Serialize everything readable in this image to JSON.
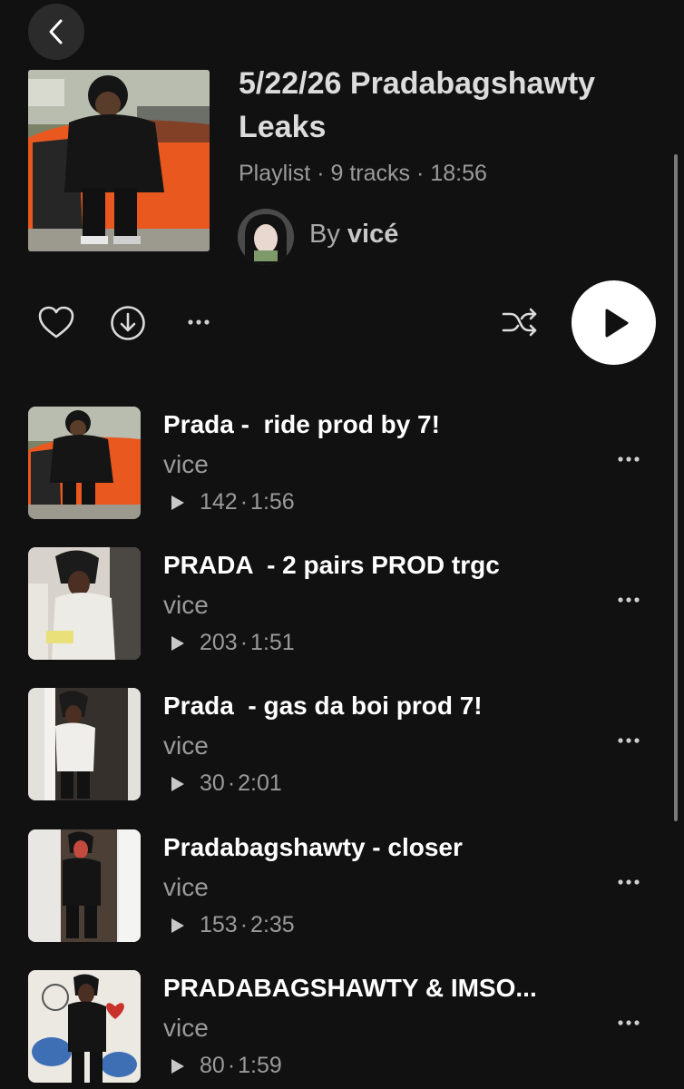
{
  "header": {
    "title": "5/22/26 Pradabagshawty Leaks",
    "type": "Playlist",
    "track_count": "9 tracks",
    "duration": "18:56",
    "by_prefix": "By",
    "owner": "vicé"
  },
  "icons": {
    "back": "chevron-left-icon",
    "like": "heart-icon",
    "download": "download-icon",
    "more": "more-horizontal-icon",
    "shuffle": "shuffle-icon",
    "play": "play-icon"
  },
  "tracks": [
    {
      "title": "Prada -  ride prod by 7!",
      "artist": "vice",
      "plays": "142",
      "duration": "1:56"
    },
    {
      "title": "PRADA  - 2 pairs PROD trgc",
      "artist": "vice",
      "plays": "203",
      "duration": "1:51"
    },
    {
      "title": "Prada  - gas da boi prod 7!",
      "artist": "vice",
      "plays": "30",
      "duration": "2:01"
    },
    {
      "title": "Pradabagshawty - closer",
      "artist": "vice",
      "plays": "153",
      "duration": "2:35"
    },
    {
      "title": "PRADABAGSHAWTY & IMSO...",
      "artist": "vice",
      "plays": "80",
      "duration": "1:59"
    }
  ],
  "colors": {
    "background": "#111111",
    "text_primary": "#ffffff",
    "text_secondary": "#9a9a9a",
    "play_button": "#ffffff"
  }
}
